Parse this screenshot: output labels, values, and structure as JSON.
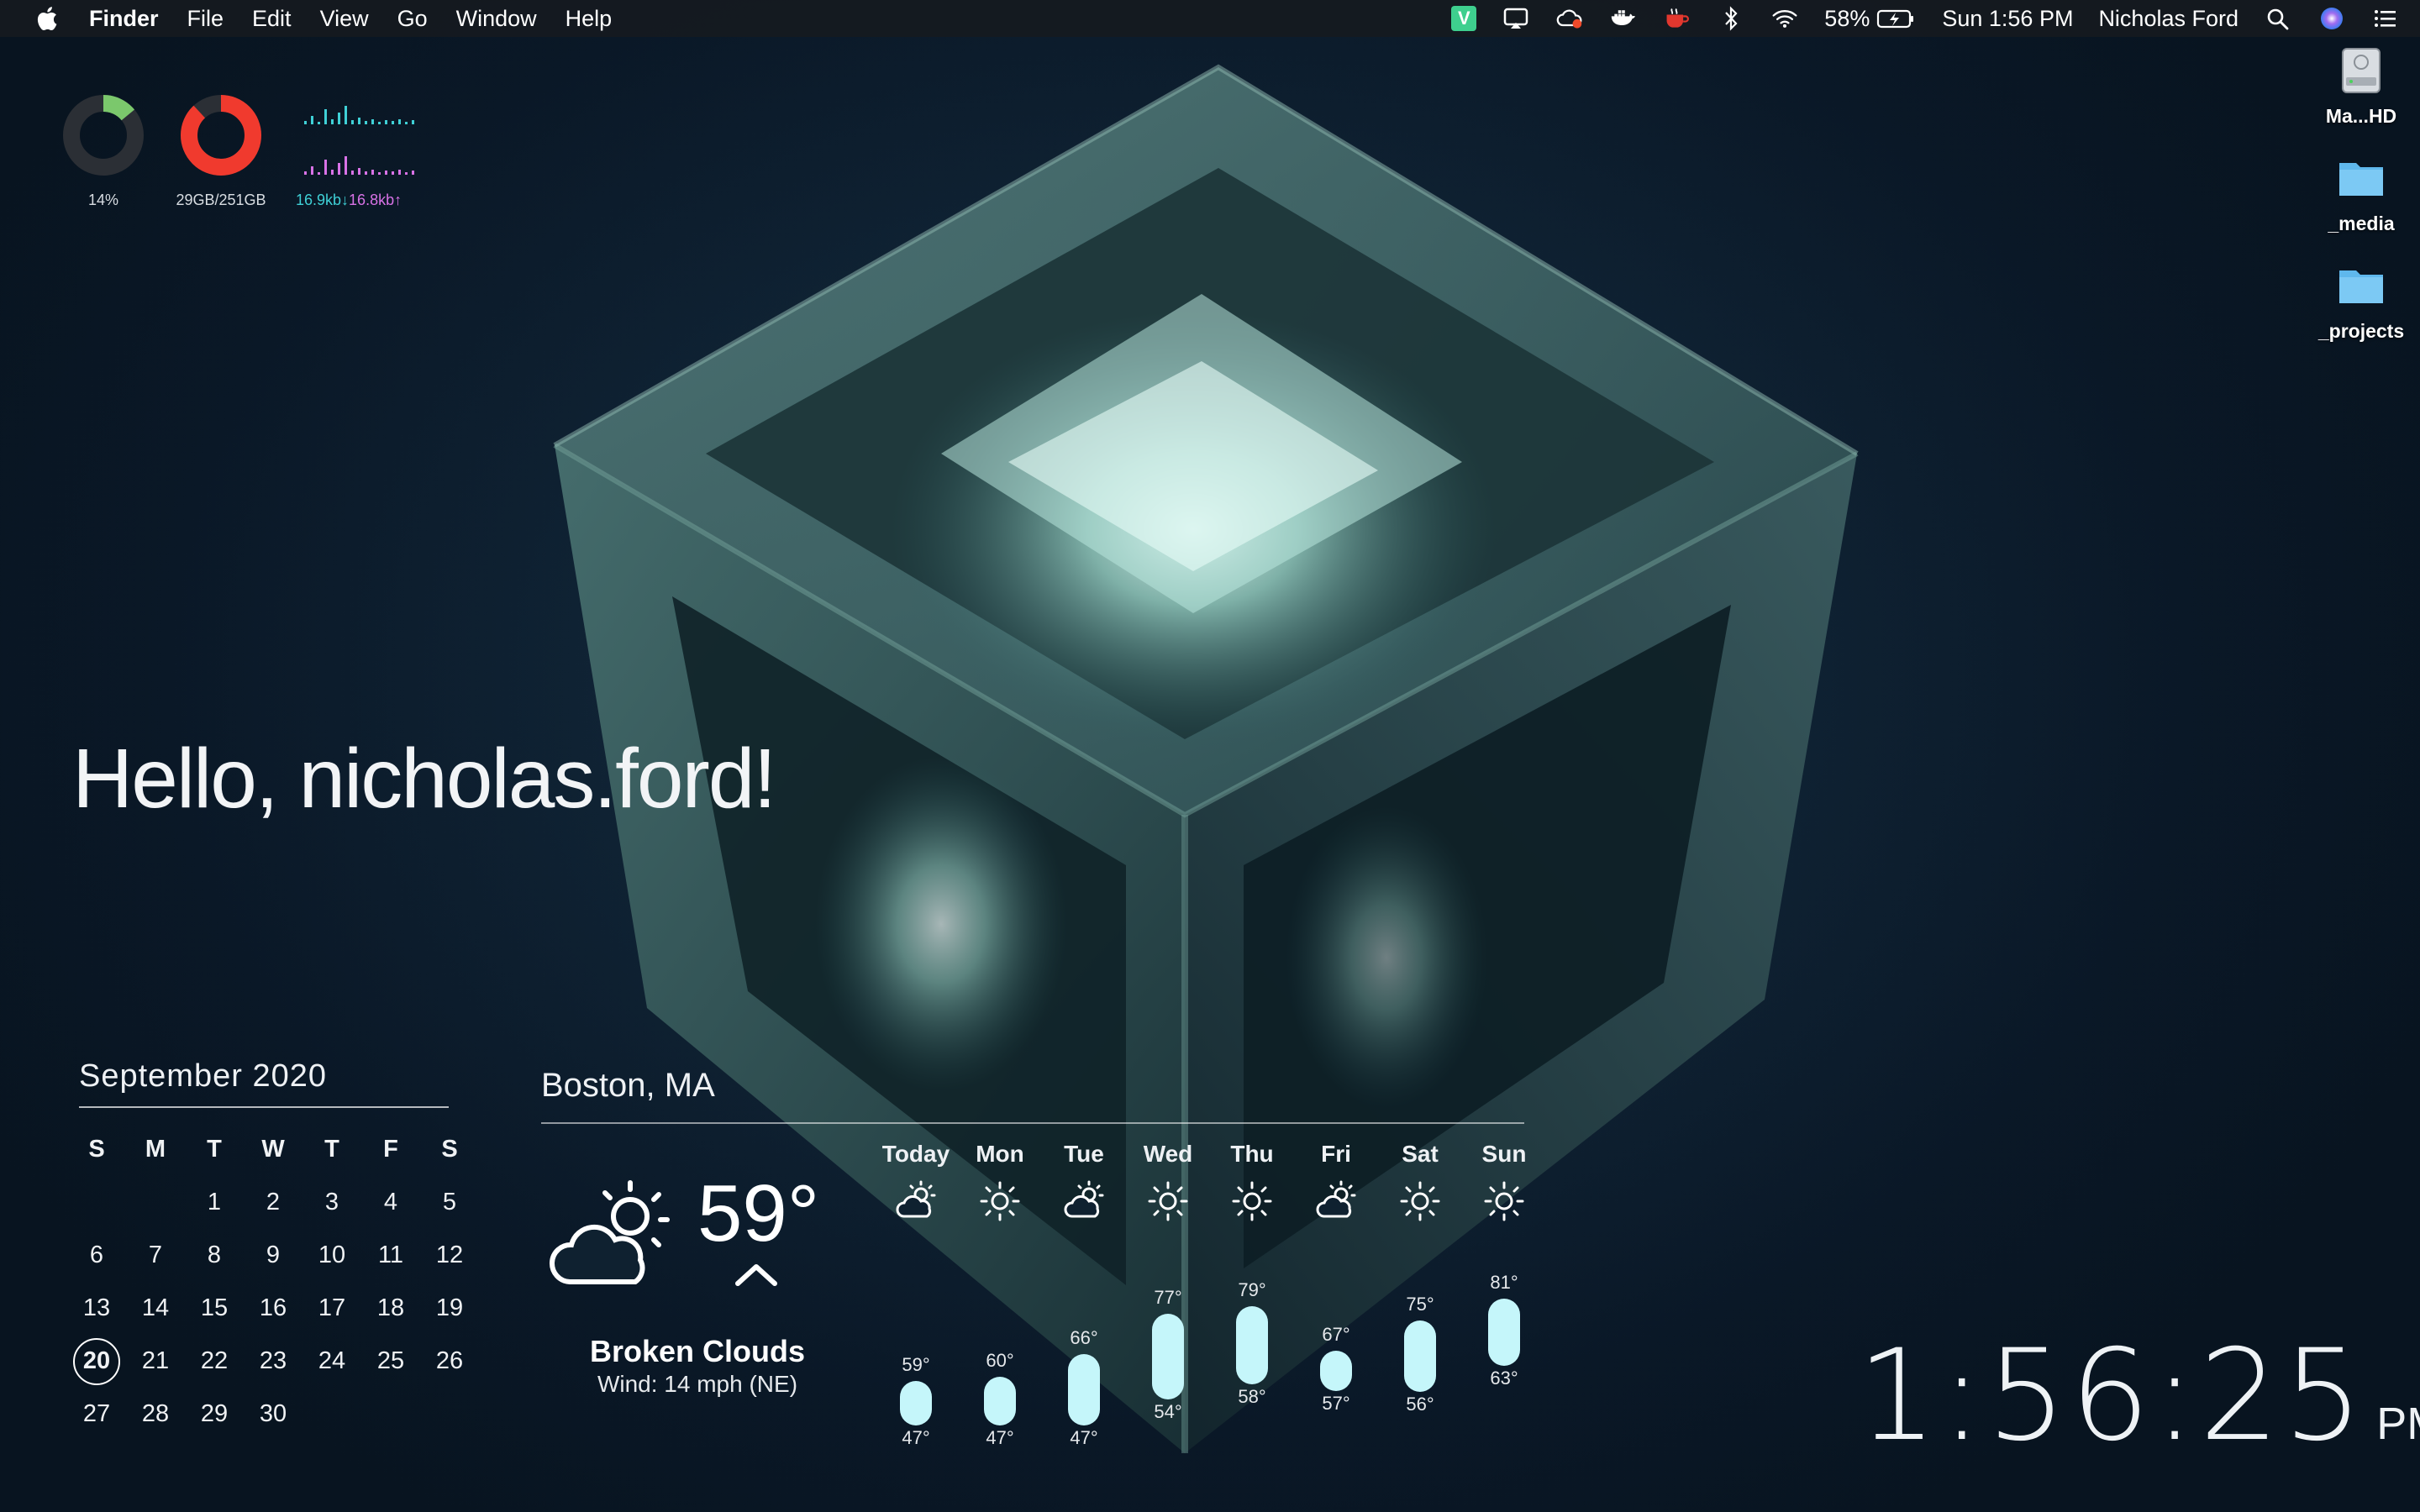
{
  "menubar": {
    "app_name": "Finder",
    "menus": [
      "File",
      "Edit",
      "View",
      "Go",
      "Window",
      "Help"
    ],
    "status_icons": [
      "vim-icon",
      "airplay-icon",
      "creative-cloud-icon",
      "docker-icon",
      "coffee-icon",
      "bluetooth-icon",
      "wifi-icon"
    ],
    "battery_percent": "58%",
    "datetime": "Sun 1:56 PM",
    "user_name": "Nicholas Ford"
  },
  "sysmon": {
    "cpu_label": "14%",
    "cpu_fraction": 0.14,
    "disk_label": "29GB/251GB",
    "disk_fraction": 0.88,
    "net_down": "16.9kb↓",
    "net_up": "16.8kb↑",
    "colors": {
      "cpu": "#7bc86c",
      "disk": "#f03a2e",
      "down": "#3fd0d6",
      "up": "#d872e6"
    }
  },
  "desktop_icons": [
    {
      "name": "Ma...HD",
      "icon": "hard-drive-icon"
    },
    {
      "name": "_media",
      "icon": "folder-icon"
    },
    {
      "name": "_projects",
      "icon": "folder-icon"
    }
  ],
  "greeting": "Hello, nicholas.ford!",
  "calendar": {
    "title": "September 2020",
    "weekdays": [
      "S",
      "M",
      "T",
      "W",
      "T",
      "F",
      "S"
    ],
    "today": "20",
    "days": [
      "",
      "",
      "1",
      "2",
      "3",
      "4",
      "5",
      "6",
      "7",
      "8",
      "9",
      "10",
      "11",
      "12",
      "13",
      "14",
      "15",
      "16",
      "17",
      "18",
      "19",
      "20",
      "21",
      "22",
      "23",
      "24",
      "25",
      "26",
      "27",
      "28",
      "29",
      "30",
      "",
      "",
      ""
    ]
  },
  "weather": {
    "city": "Boston, MA",
    "current_temp": "59°",
    "condition": "Broken Clouds",
    "wind": "Wind: 14 mph (NE)",
    "current_icon": "partly-cloudy-icon",
    "forecast": [
      {
        "day": "Today",
        "icon": "partly-cloudy-icon",
        "hi": "59°",
        "lo": "47°"
      },
      {
        "day": "Mon",
        "icon": "sun-icon",
        "hi": "60°",
        "lo": "47°"
      },
      {
        "day": "Tue",
        "icon": "partly-cloudy-icon",
        "hi": "66°",
        "lo": "47°"
      },
      {
        "day": "Wed",
        "icon": "sun-icon",
        "hi": "77°",
        "lo": "54°"
      },
      {
        "day": "Thu",
        "icon": "sun-icon",
        "hi": "79°",
        "lo": "58°"
      },
      {
        "day": "Fri",
        "icon": "partly-cloudy-icon",
        "hi": "67°",
        "lo": "57°"
      },
      {
        "day": "Sat",
        "icon": "sun-icon",
        "hi": "75°",
        "lo": "56°"
      },
      {
        "day": "Sun",
        "icon": "sun-icon",
        "hi": "81°",
        "lo": "63°"
      }
    ]
  },
  "clock": {
    "time": "1:56:25",
    "ampm": "PM"
  }
}
